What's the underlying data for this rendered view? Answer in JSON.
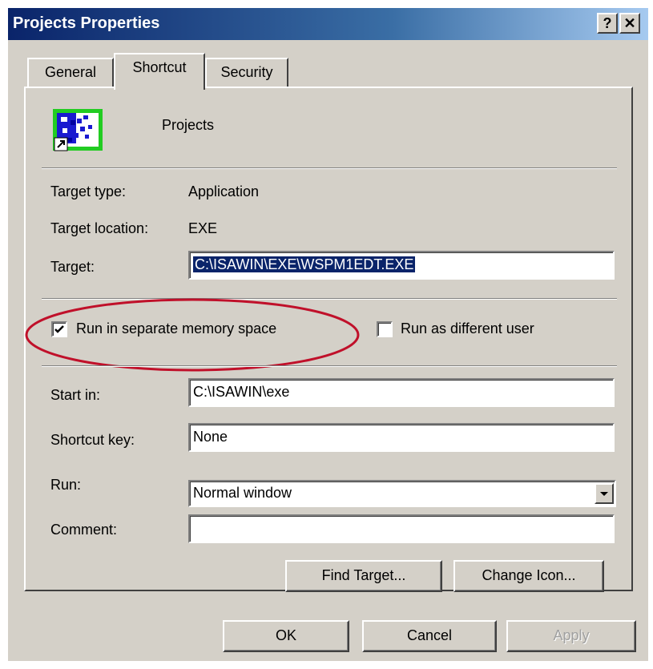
{
  "window": {
    "title": "Projects Properties",
    "help_button": "?",
    "close_button": "✕"
  },
  "tabs": [
    {
      "label": "General",
      "active": false
    },
    {
      "label": "Shortcut",
      "active": true
    },
    {
      "label": "Security",
      "active": false
    }
  ],
  "header": {
    "name": "Projects",
    "icon": "shortcut-application-icon"
  },
  "target_type": {
    "label": "Target type:",
    "value": "Application"
  },
  "target_location": {
    "label": "Target location:",
    "value": "EXE"
  },
  "target": {
    "label": "Target:",
    "value": "C:\\ISAWIN\\EXE\\WSPM1EDT.EXE"
  },
  "options": {
    "separate_memory": {
      "label": "Run in separate memory space",
      "checked": true
    },
    "different_user": {
      "label": "Run as different user",
      "checked": false
    },
    "annotation_color": "#c0102a"
  },
  "start_in": {
    "label": "Start in:",
    "value": "C:\\ISAWIN\\exe"
  },
  "shortcut_key": {
    "label": "Shortcut key:",
    "value": "None"
  },
  "run": {
    "label": "Run:",
    "value": "Normal window"
  },
  "comment": {
    "label": "Comment:",
    "value": ""
  },
  "actions": {
    "find_target": "Find Target...",
    "change_icon": "Change Icon..."
  },
  "footer": {
    "ok": "OK",
    "cancel": "Cancel",
    "apply": "Apply"
  }
}
